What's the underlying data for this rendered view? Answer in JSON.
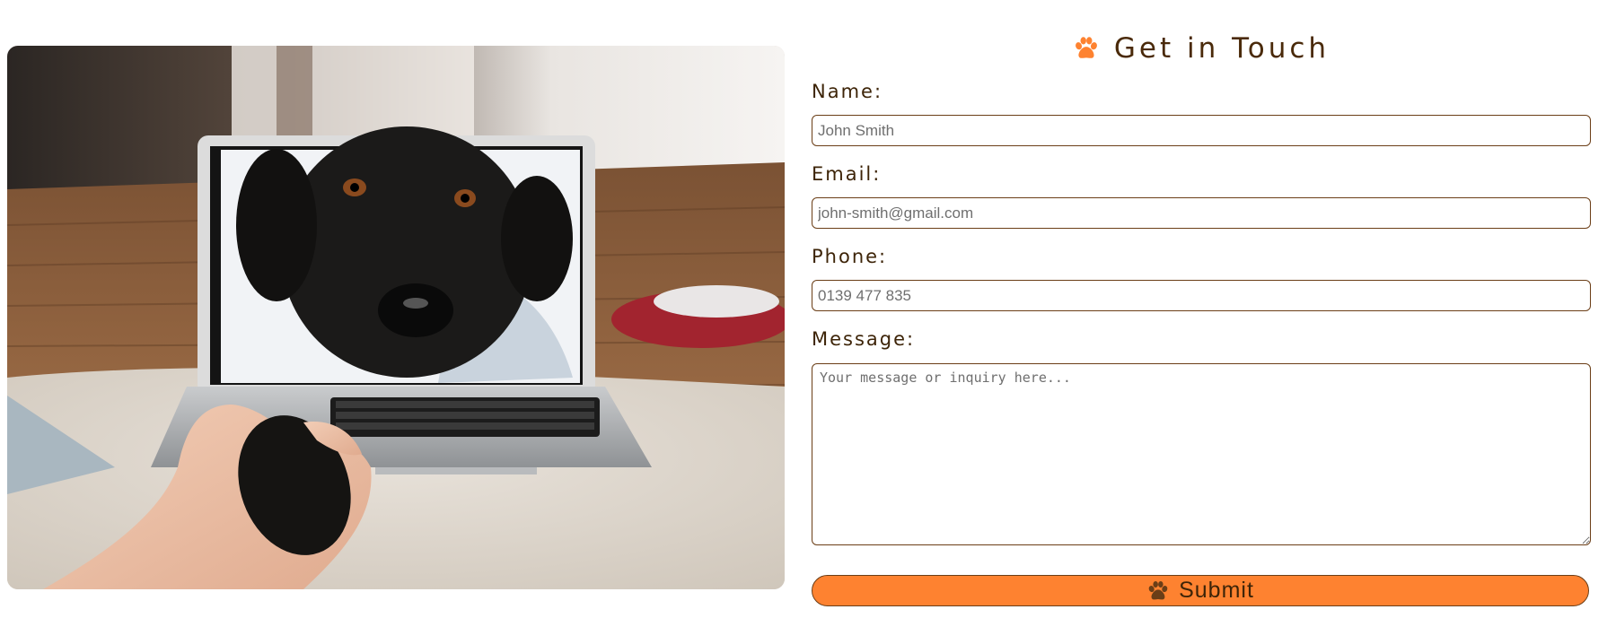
{
  "form": {
    "title": "Get in Touch",
    "name_label": "Name:",
    "name_placeholder": "John Smith",
    "email_label": "Email:",
    "email_placeholder": "john-smith@gmail.com",
    "phone_label": "Phone:",
    "phone_placeholder": "0139 477 835",
    "message_label": "Message:",
    "message_placeholder": "Your message or inquiry here...",
    "submit_label": "Submit"
  },
  "icons": {
    "title_icon": "paw-icon",
    "submit_icon": "paw-icon"
  },
  "colors": {
    "accent": "#fe8230",
    "text": "#4a2a0a",
    "border": "#6b3e17",
    "submit_icon": "#6b3e17"
  }
}
